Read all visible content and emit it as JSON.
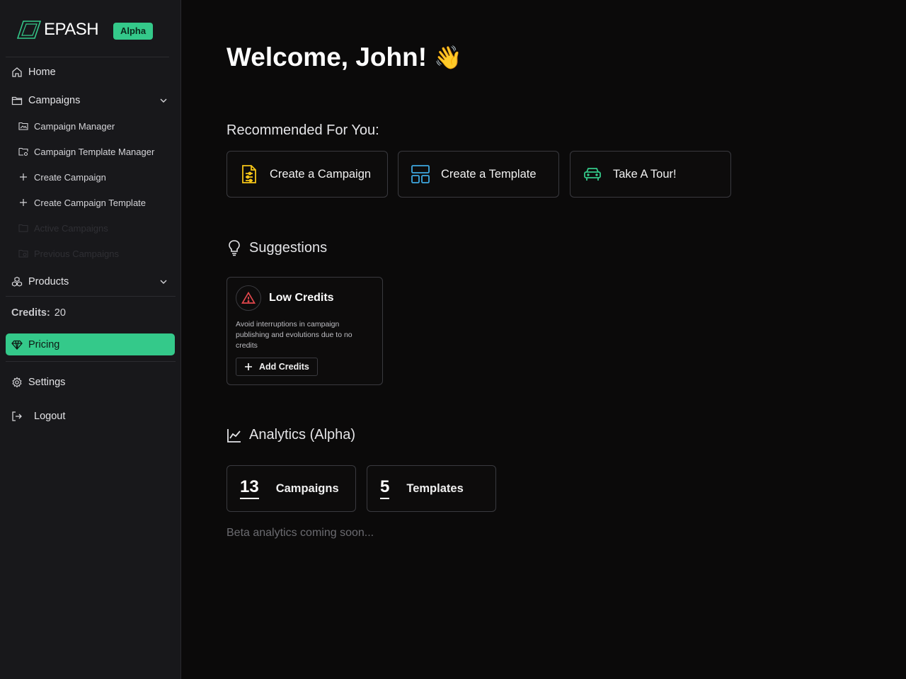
{
  "brand": {
    "name": "EPASH",
    "badge": "Alpha",
    "accent": "#34c98a"
  },
  "sidebar": {
    "home": "Home",
    "campaigns": {
      "label": "Campaigns",
      "items": [
        {
          "label": "Campaign Manager",
          "enabled": true
        },
        {
          "label": "Campaign Template Manager",
          "enabled": true
        },
        {
          "label": "Create Campaign",
          "enabled": true
        },
        {
          "label": "Create Campaign Template",
          "enabled": true
        },
        {
          "label": "Active Campaigns",
          "enabled": false
        },
        {
          "label": "Previous Campaigns",
          "enabled": false
        }
      ]
    },
    "products": "Products",
    "credits_label": "Credits:",
    "credits_value": "20",
    "pricing": "Pricing",
    "settings": "Settings",
    "logout": "Logout"
  },
  "main": {
    "welcome": "Welcome, John!",
    "wave": "👋",
    "recommended_title": "Recommended For You:",
    "recommended": [
      {
        "label": "Create a Campaign",
        "icon": "document-sliders-icon",
        "color": "#f5c518"
      },
      {
        "label": "Create a Template",
        "icon": "layout-grid-icon",
        "color": "#3ea8e0"
      },
      {
        "label": "Take A Tour!",
        "icon": "car-icon",
        "color": "#34c98a"
      }
    ],
    "suggestions_title": "Suggestions",
    "suggestion": {
      "title": "Low Credits",
      "description": "Avoid interruptions in campaign publishing and evolutions due to no credits",
      "action": "Add Credits",
      "icon_color": "#e5484d"
    },
    "analytics_title": "Analytics (Alpha)",
    "stats": [
      {
        "value": "13",
        "label": "Campaigns"
      },
      {
        "value": "5",
        "label": "Templates"
      }
    ],
    "beta_note": "Beta analytics coming soon..."
  }
}
